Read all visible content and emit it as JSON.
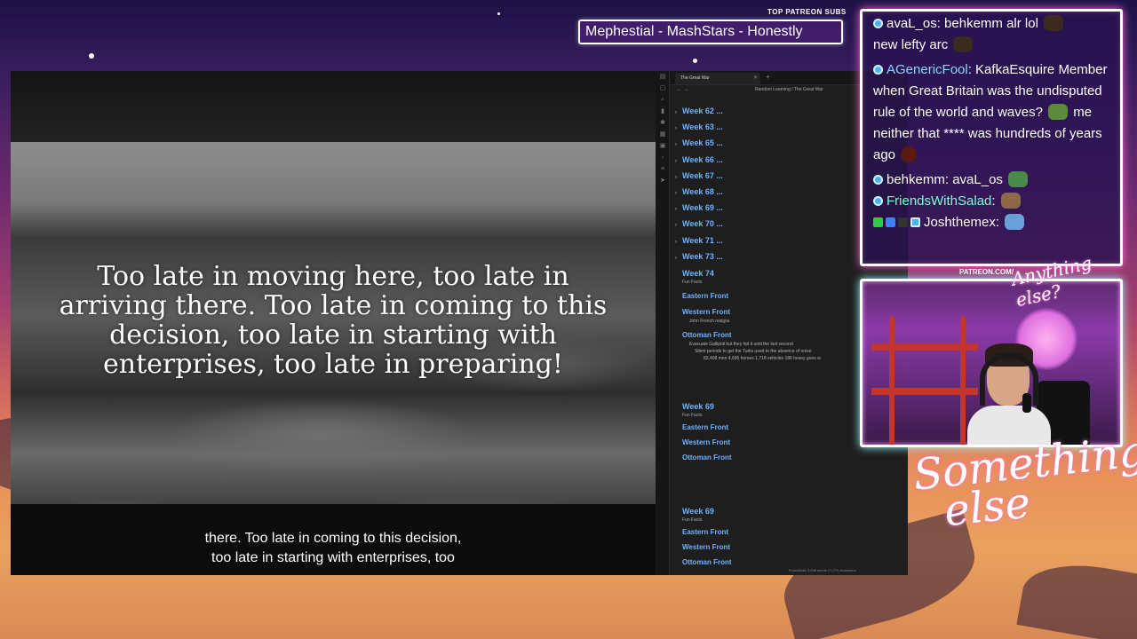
{
  "ticker": {
    "title": "TOP PATREON SUBS",
    "text": "Mephestial - MashStars - Honestly"
  },
  "video": {
    "quote": "Too late in moving here, too late in arriving there.  Too late in coming to this decision, too late in starting with enterprises, too late in preparing!",
    "caption_line1": "there. Too late in coming to this decision,",
    "caption_line2": "too late in starting with enterprises, too"
  },
  "notes": {
    "tab_title": "The Great War",
    "breadcrumb": "Random Learning  /  The Great War",
    "weeks": [
      "Week 62 ...",
      "Week 63 ...",
      "Week 65 ...",
      "Week 66 ...",
      "Week 67 ...",
      "Week 68 ...",
      "Week 69 ...",
      "Week 70 ...",
      "Week 71 ...",
      "Week 73 ..."
    ],
    "week74": {
      "title": "Week 74",
      "sub": "Fun Facts",
      "eastern": "Eastern Front",
      "western": "Western Front",
      "western_note": "John French resigns",
      "ottoman": "Ottoman Front",
      "ottoman_note1": "Evacuate Gallipoli but they hid it until the last second",
      "ottoman_note2": "Silent periods to get the Turks used to the absence of noise",
      "ottoman_note3": "83,408 men 4,695 horses 1,718 vehicles  186 heavy guns w"
    },
    "week69a": {
      "title": "Week 69",
      "sub": "Fun Facts",
      "eastern": "Eastern Front",
      "western": "Western Front",
      "ottoman": "Ottoman Front"
    },
    "week69b": {
      "title": "Week 69",
      "sub": "Fun Facts",
      "eastern": "Eastern Front",
      "western": "Western Front",
      "ottoman": "Ottoman Front"
    },
    "status": "9 backlinks      3,458 words  17,270 characters"
  },
  "chat": {
    "m1_user": "avaL_os",
    "m1_text": ": behkemm alr lol",
    "m1_text2": "new lefty arc",
    "m2_user": "AGenericFool",
    "m2_text": ": KafkaEsquire Member when Great Britain was the undisputed rule of the world and waves?",
    "m2_text2": " me neither that **** was hundreds of years ago",
    "m3_user": "behkemm",
    "m3_text": ": avaL_os",
    "m4_user": "FriendsWithSalad",
    "m4_text": ":",
    "m5_user": "Joshthemex",
    "m5_text": ":"
  },
  "webcam": {
    "label": "PATREON.COM/",
    "logo": "Anything else?"
  },
  "brand": "Something\n  else",
  "colors": {
    "chat_border_glow": "#ff6ad5",
    "link_blue": "#6fb2ff",
    "notes_bg": "#1e1e1e"
  }
}
